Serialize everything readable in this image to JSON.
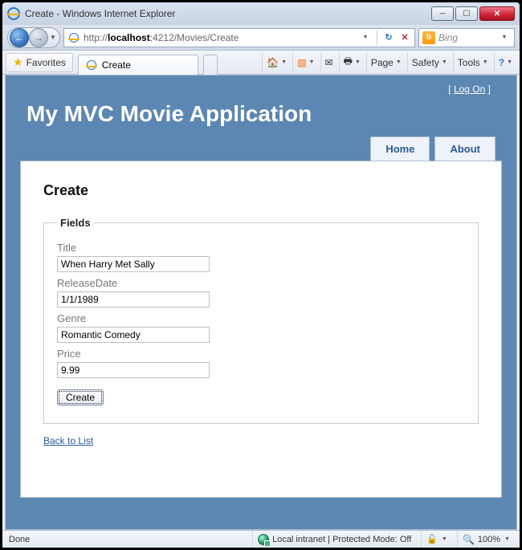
{
  "window": {
    "title": "Create - Windows Internet Explorer"
  },
  "nav": {
    "url_prefix": "http://",
    "url_host": "localhost",
    "url_rest": ":4212/Movies/Create"
  },
  "search": {
    "placeholder": "Bing"
  },
  "favbar": {
    "favorites": "Favorites",
    "tab_title": "Create"
  },
  "cmd": {
    "page": "Page",
    "safety": "Safety",
    "tools": "Tools"
  },
  "page": {
    "logon": "Log On",
    "app_title": "My MVC Movie Application",
    "nav_home": "Home",
    "nav_about": "About",
    "heading": "Create",
    "legend": "Fields",
    "title_label": "Title",
    "title_value": "When Harry Met Sally",
    "release_label": "ReleaseDate",
    "release_value": "1/1/1989",
    "genre_label": "Genre",
    "genre_value": "Romantic Comedy",
    "price_label": "Price",
    "price_value": "9.99",
    "create_btn": "Create",
    "back_link": "Back to List"
  },
  "status": {
    "left": "Done",
    "zone": "Local intranet | Protected Mode: Off",
    "zoom": "100%"
  }
}
